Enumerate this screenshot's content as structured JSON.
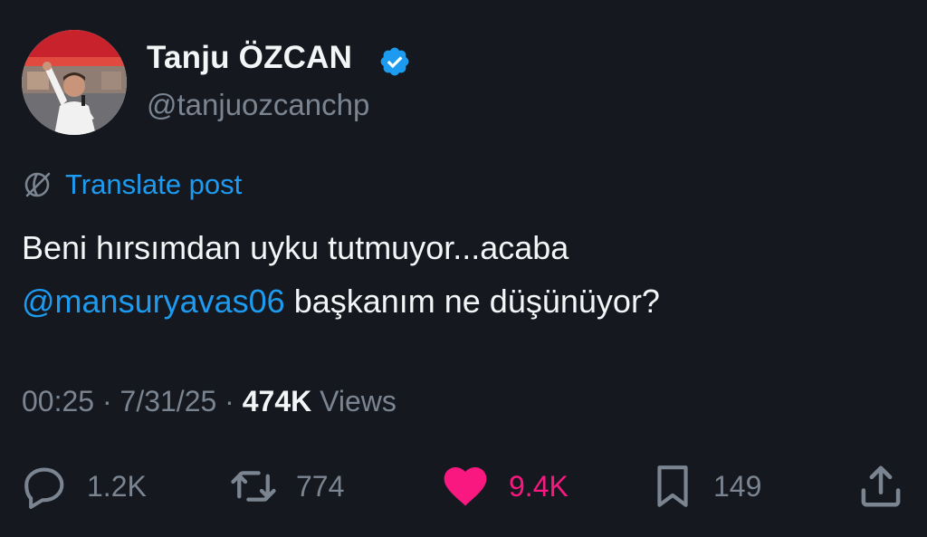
{
  "author": {
    "name": "Tanju ÖZCAN",
    "handle": "@tanjuozcanchp",
    "verified": true,
    "verified_color": "#1d9bf0"
  },
  "translate": {
    "label": "Translate post",
    "icon": "globe-icon"
  },
  "post": {
    "text_before_mention": "Beni hırsımdan uyku tutmuyor...acaba",
    "mention": "@mansuryavas06",
    "text_after_mention": "başkanım ne düşünüyor?"
  },
  "meta": {
    "time": "00:25",
    "date": "7/31/25",
    "separator": "·",
    "views_count": "474K",
    "views_label": "Views"
  },
  "actions": {
    "reply": {
      "icon": "reply-icon",
      "count": "1.2K"
    },
    "repost": {
      "icon": "repost-icon",
      "count": "774"
    },
    "like": {
      "icon": "heart-icon",
      "count": "9.4K",
      "liked": true,
      "color": "#f91880"
    },
    "bookmark": {
      "icon": "bookmark-icon",
      "count": "149"
    },
    "share": {
      "icon": "share-icon"
    }
  },
  "colors": {
    "background": "#15181f",
    "accent": "#1d9bf0",
    "muted": "#7b8591",
    "text": "#f4f5f6"
  }
}
